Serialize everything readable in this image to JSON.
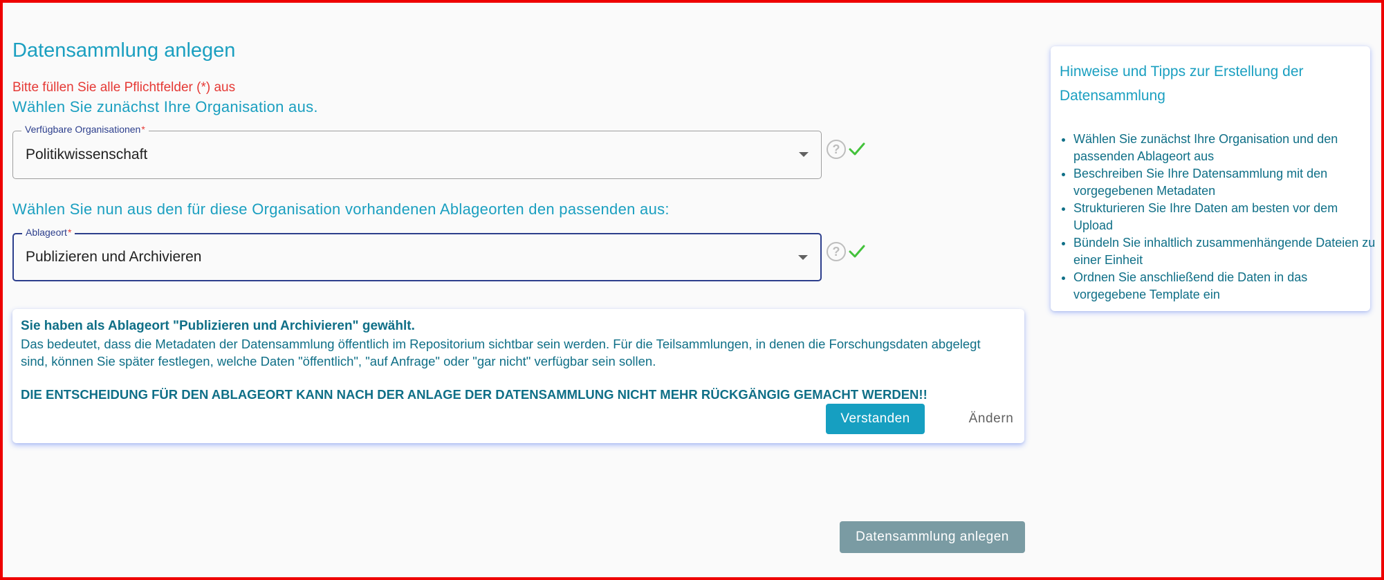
{
  "page": {
    "title": "Datensammlung anlegen",
    "required_hint": "Bitte füllen Sie alle Pflichtfelder (*) aus",
    "step1_text": "Wählen Sie zunächst Ihre Organisation aus.",
    "step2_text": "Wählen Sie nun aus den für diese Organisation vorhandenen Ablageorten den passenden aus:"
  },
  "organisation_select": {
    "label": "Verfügbare Organisationen",
    "required_marker": "*",
    "value": "Politikwissenschaft",
    "help_glyph": "?"
  },
  "storage_select": {
    "label": "Ablageort",
    "required_marker": "*",
    "value": "Publizieren und Archivieren",
    "help_glyph": "?"
  },
  "info_card": {
    "headline": "Sie haben als Ablageort \"Publizieren und Archivieren\" gewählt.",
    "body": "Das bedeutet, dass die Metadaten der Datensammlung öffentlich im Repositorium sichtbar sein werden. Für die Teilsammlungen, in denen die Forschungsdaten abgelegt sind, können Sie später festlegen, welche Daten \"öffentlich\", \"auf Anfrage\" oder \"gar nicht\" verfügbar sein sollen.",
    "warning": "DIE ENTSCHEIDUNG FÜR DEN ABLAGEORT KANN NACH DER ANLAGE DER DATENSAMMLUNG NICHT MEHR RÜCKGÄNGIG GEMACHT WERDEN!!",
    "confirm_label": "Verstanden",
    "change_label": "Ändern"
  },
  "tips": {
    "title": "Hinweise und Tipps zur Erstellung der Datensammlung",
    "items": [
      "Wählen Sie zunächst Ihre Organisation und den passenden Ablageort aus",
      "Beschreiben Sie Ihre Datensammlung mit den vorgegebenen Metadaten",
      "Strukturieren Sie Ihre Daten am besten vor dem Upload",
      "Bündeln Sie inhaltlich zusammenhängende Dateien zu einer Einheit",
      "Ordnen Sie anschließend die Daten in das vorgegebene Template ein"
    ]
  },
  "submit_label": "Datensammlung anlegen",
  "colors": {
    "accent": "#1a9fc0",
    "text_dark_teal": "#0f6f87",
    "error": "#e53935",
    "success": "#43c23b",
    "primary_button": "#169fc1",
    "disabled_button": "#7a9ba3",
    "focus_border": "#2c3e8c",
    "frame_border": "#ee0000"
  },
  "icons": {
    "help": "help-circle-icon",
    "check": "check-icon",
    "dropdown": "chevron-down-icon"
  }
}
